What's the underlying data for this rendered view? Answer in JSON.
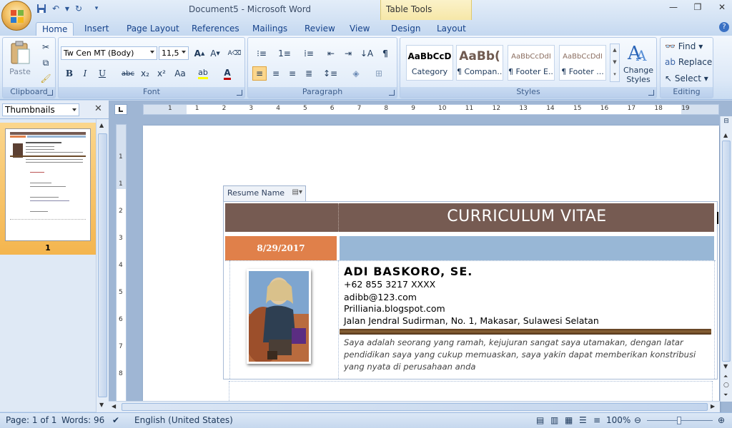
{
  "window": {
    "title": "Document5 - Microsoft Word",
    "contextual_tab_group": "Table Tools"
  },
  "ribbon_tabs": [
    "Home",
    "Insert",
    "Page Layout",
    "References",
    "Mailings",
    "Review",
    "View",
    "Design",
    "Layout"
  ],
  "active_tab": "Home",
  "clipboard": {
    "paste_label": "Paste",
    "group_label": "Clipboard"
  },
  "font": {
    "font_name": "Tw Cen MT (Body)",
    "font_size": "11,5",
    "group_label": "Font",
    "bold": "B",
    "italic": "I",
    "underline": "U",
    "strike": "abc",
    "subscript": "x₂",
    "superscript": "x²",
    "change_case": "Aa"
  },
  "paragraph": {
    "group_label": "Paragraph"
  },
  "styles": {
    "group_label": "Styles",
    "items": [
      {
        "sample": "AaBbCcD",
        "name": "Category"
      },
      {
        "sample": "AaBb(",
        "name": "¶ Compan..."
      },
      {
        "sample": "AaBbCcDdI",
        "name": "¶ Footer E..."
      },
      {
        "sample": "AaBbCcDdI",
        "name": "¶ Footer ..."
      }
    ],
    "change_styles": "Change Styles"
  },
  "editing": {
    "group_label": "Editing",
    "find": "Find",
    "replace": "Replace",
    "select": "Select"
  },
  "nav_pane": {
    "view": "Thumbnails",
    "page_number": "1"
  },
  "document": {
    "content_control_label": "Resume Name",
    "title": "CURRICULUM VITAE",
    "date": "8/29/2017",
    "name": "ADI BASKORO, SE.",
    "phone": "+62 855 3217 XXXX",
    "email": "adibb@123.com",
    "website": "Prilliania.blogspot.com",
    "address": "Jalan Jendral Sudirman, No. 1, Makasar, Sulawesi Selatan",
    "summary": "Saya adalah seorang yang ramah, kejujuran sangat saya utamakan, dengan latar pendidikan saya yang cukup memuaskan, saya yakin dapat memberikan konstribusi yang nyata di perusahaan anda"
  },
  "ruler_numbers": [
    "1",
    "1",
    "2",
    "3",
    "4",
    "5",
    "6",
    "7",
    "8",
    "9",
    "10",
    "11",
    "12",
    "13",
    "14",
    "15",
    "16",
    "17",
    "18",
    "19"
  ],
  "vruler_numbers": [
    "1",
    "1",
    "2",
    "3",
    "4",
    "5",
    "6",
    "7",
    "8"
  ],
  "status": {
    "page": "Page: 1 of 1",
    "words": "Words: 96",
    "language": "English (United States)",
    "zoom": "100%"
  },
  "colors": {
    "cv_header": "#765b52",
    "cv_date": "#e0804a",
    "cv_bar": "#98b7d6",
    "thumbnail_selected": "#f4b54e"
  }
}
